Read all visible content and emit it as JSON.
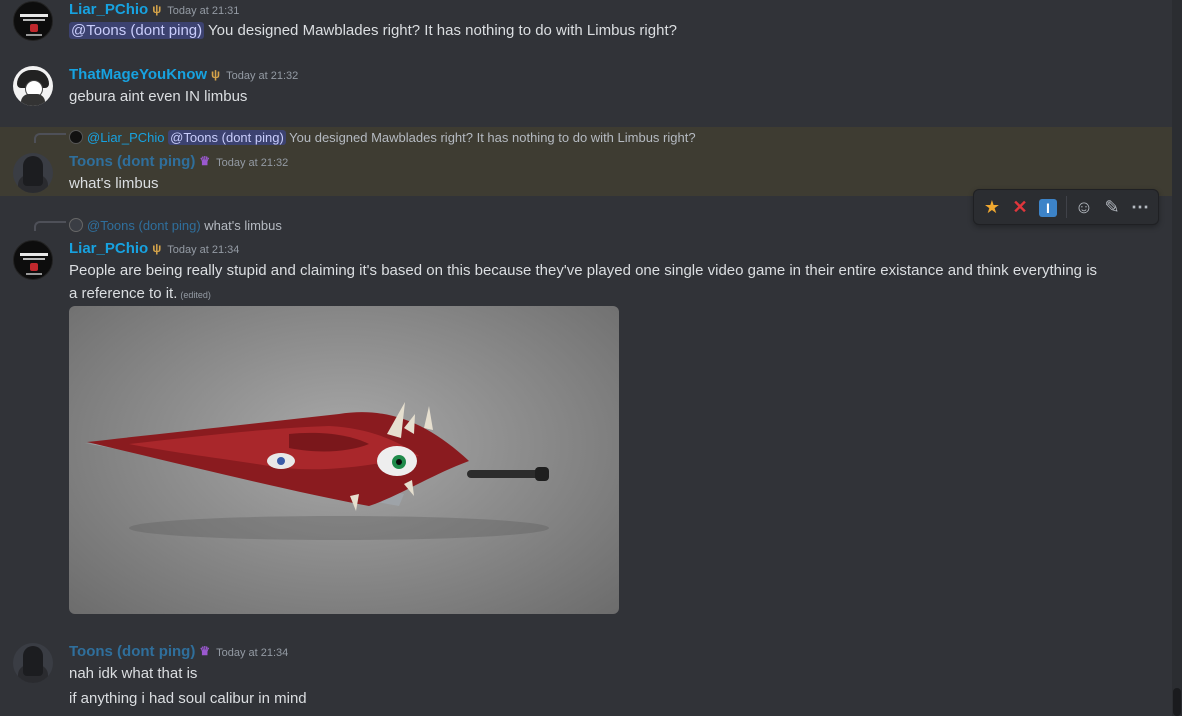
{
  "messages": [
    {
      "author": "Liar_PChio",
      "timestamp": "Today at 21:31",
      "mention": "@Toons (dont ping)",
      "text": " You designed Mawblades right? It has nothing to do with Limbus right?"
    },
    {
      "author": "ThatMageYouKnow",
      "timestamp": "Today at 21:32",
      "text": "gebura aint even IN limbus"
    },
    {
      "reply": {
        "author": "@Liar_PChio",
        "mention": "@Toons (dont ping)",
        "text": " You designed Mawblades right? It has nothing to do with Limbus right?"
      },
      "author": "Toons (dont ping)",
      "timestamp": "Today at 21:32",
      "text": "what's limbus"
    },
    {
      "reply": {
        "author": "@Toons (dont ping)",
        "text": " what's limbus"
      },
      "author": "Liar_PChio",
      "timestamp": "Today at 21:34",
      "text_line1": "People are being really stupid and claiming it's based on this because they've played one single video game in their entire existance and think everything is",
      "text_line2": "a reference to it.",
      "edited": "(edited)"
    },
    {
      "author": "Toons (dont ping)",
      "timestamp": "Today at 21:34",
      "text_line1": "nah idk what that is",
      "text_line2": "if anything i had soul calibur in mind"
    }
  ],
  "toolbar": {
    "icons": [
      "star-icon",
      "x-mark-icon",
      "i-block-icon",
      "add-reaction-icon",
      "edit-icon",
      "more-icon"
    ]
  },
  "colors": {
    "background": "#313338",
    "highlight": "#3e3c32",
    "username_liar": "#17a2e0",
    "username_toons": "#2f6f9c",
    "mention_bg": "#3c4270"
  }
}
